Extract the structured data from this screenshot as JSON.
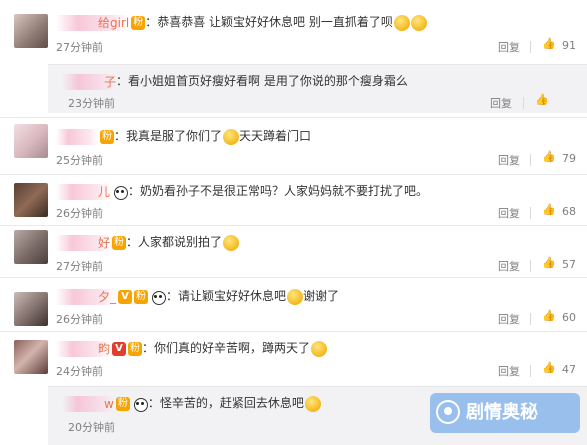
{
  "comments": [
    {
      "name": "给girl",
      "text": "：恭喜恭喜 让颖宝好好休息吧 别一直抓着了呗",
      "time": "27分钟前",
      "reply": "回复",
      "likes": "91"
    },
    {
      "name": "子",
      "text": "：看小姐姐首页好瘦好看啊 是用了你说的那个瘦身霜么",
      "time": "23分钟前",
      "reply": "回复",
      "likes": ""
    },
    {
      "name": "",
      "text": "：我真是服了你们了",
      "text2": "天天蹲着门口",
      "time": "25分钟前",
      "reply": "回复",
      "likes": "79"
    },
    {
      "name": "儿",
      "text": "：奶奶看孙子不是很正常吗？人家妈妈就不要打扰了吧。",
      "time": "26分钟前",
      "reply": "回复",
      "likes": "68"
    },
    {
      "name": "好",
      "text": "：人家都说别拍了",
      "time": "27分钟前",
      "reply": "回复",
      "likes": "57"
    },
    {
      "name": "夕_",
      "text": "：请让颖宝好好休息吧",
      "text2": "谢谢了",
      "time": "26分钟前",
      "reply": "回复",
      "likes": "60"
    },
    {
      "name": "畇",
      "text": "：你们真的好辛苦啊，蹲两天了",
      "time": "24分钟前",
      "reply": "回复",
      "likes": "47"
    },
    {
      "name": "w",
      "text": "：怪辛苦的，赶紧回去休息吧",
      "time": "20分钟前",
      "reply": "回复",
      "likes": ""
    }
  ],
  "watermark": {
    "text": "剧情奥秘"
  },
  "colors": {
    "name": "#eb7350",
    "muted": "#808080",
    "reply_bg": "#f2f2f5"
  }
}
